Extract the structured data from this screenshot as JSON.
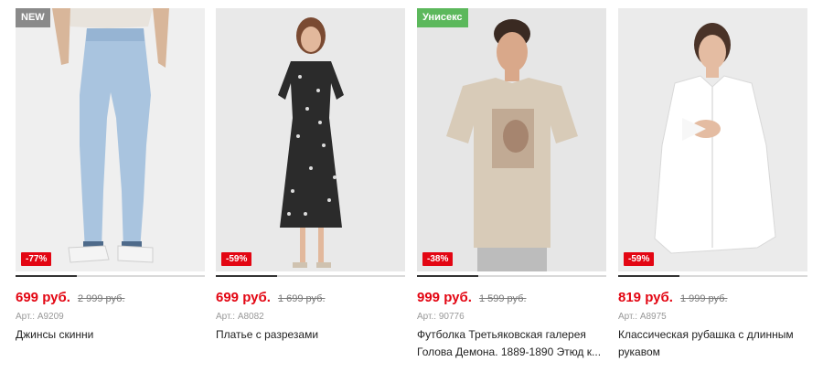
{
  "products": [
    {
      "badge": "NEW",
      "badge_color": "#8a8a8a",
      "discount": "-77%",
      "price": "699 руб.",
      "old_price": "2 999 руб.",
      "article": "Арт.: A9209",
      "name": "Джинсы скинни",
      "image_icon": "jeans-photo"
    },
    {
      "badge": "",
      "discount": "-59%",
      "price": "699 руб.",
      "old_price": "1 699 руб.",
      "article": "Арт.: A8082",
      "name": "Платье с разрезами",
      "image_icon": "dress-photo"
    },
    {
      "badge": "Унисекс",
      "badge_color": "#5cb85c",
      "discount": "-38%",
      "price": "999 руб.",
      "old_price": "1 599 руб.",
      "article": "Арт.: 90776",
      "name": "Футболка Третьяковская галерея Голова Демона. 1889-1890 Этюд к...",
      "image_icon": "tshirt-photo"
    },
    {
      "badge": "",
      "discount": "-59%",
      "price": "819 руб.",
      "old_price": "1 999 руб.",
      "article": "Арт.: A8975",
      "name": "Классическая рубашка с длинным рукавом",
      "image_icon": "shirt-photo"
    }
  ],
  "colors": {
    "accent": "#e30613"
  }
}
